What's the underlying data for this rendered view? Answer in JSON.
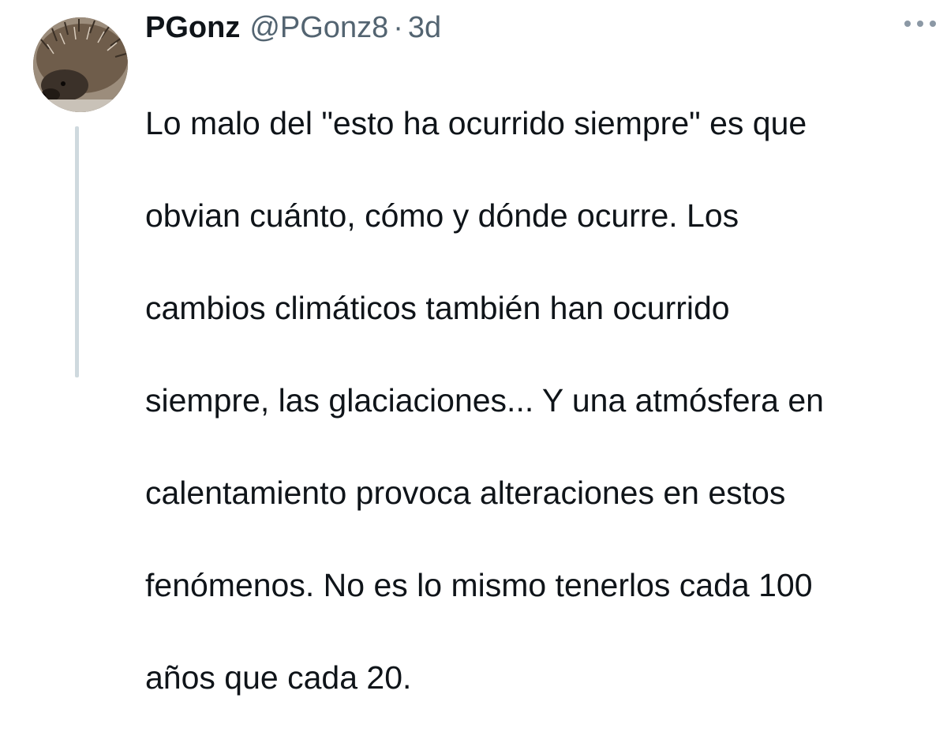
{
  "tweet": {
    "display_name": "PGonz",
    "handle": "@PGonz8",
    "separator": "·",
    "time": "3d",
    "text_lines": [
      "Lo malo del \"esto ha ocurrido siempre\" es que",
      "obvian cuánto, cómo y dónde ocurre. Los",
      "cambios climáticos también han ocurrido",
      "siempre, las glaciaciones... Y una atmósfera en",
      "calentamiento provoca alteraciones en estos",
      "fenómenos. No es lo mismo tenerlos cada 100",
      "años que cada 20."
    ],
    "avatar_icon": "hedgehog-avatar",
    "more_icon": "more-options-icon"
  },
  "colors": {
    "text": "#0f1419",
    "secondary": "#536471",
    "thread_line": "#cfd9de"
  }
}
